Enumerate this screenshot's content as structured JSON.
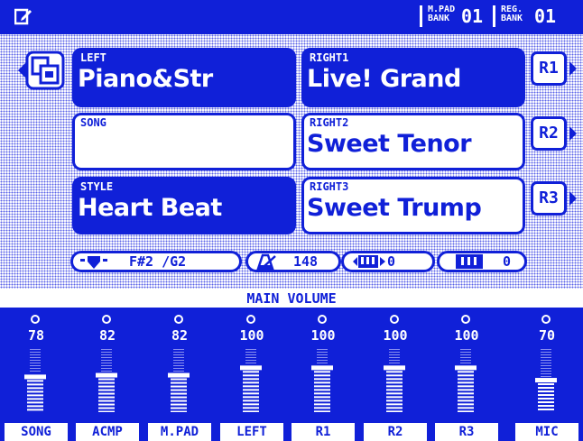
{
  "topbar": {
    "mpad_label_1": "M.PAD",
    "mpad_label_2": "BANK",
    "mpad_value": "01",
    "reg_label_1": "REG.",
    "reg_label_2": "BANK",
    "reg_value": "01"
  },
  "parts": {
    "left": {
      "label": "LEFT",
      "value": "Piano&Str"
    },
    "right1": {
      "label": "RIGHT1",
      "value": "Live! Grand"
    },
    "song": {
      "label": "SONG",
      "value": ""
    },
    "right2": {
      "label": "RIGHT2",
      "value": "Sweet Tenor"
    },
    "style": {
      "label": "STYLE",
      "value": "Heart Beat"
    },
    "right3": {
      "label": "RIGHT3",
      "value": "Sweet Trump"
    }
  },
  "right_buttons": [
    "R1",
    "R2",
    "R3"
  ],
  "status": {
    "transpose": "F#2 /G2",
    "tempo": "148",
    "transpose_value": "0",
    "octave_value": "0"
  },
  "main_volume": {
    "title": "MAIN VOLUME",
    "channels": [
      {
        "name": "SONG",
        "value": "78"
      },
      {
        "name": "ACMP",
        "value": "82"
      },
      {
        "name": "M.PAD",
        "value": "82"
      },
      {
        "name": "LEFT",
        "value": "100"
      },
      {
        "name": "R1",
        "value": "100"
      },
      {
        "name": "R2",
        "value": "100"
      },
      {
        "name": "R3",
        "value": "100"
      },
      {
        "name": "MIC",
        "value": "70"
      }
    ]
  },
  "colors": {
    "accent": "#1020d8",
    "background": "#ffffff"
  }
}
